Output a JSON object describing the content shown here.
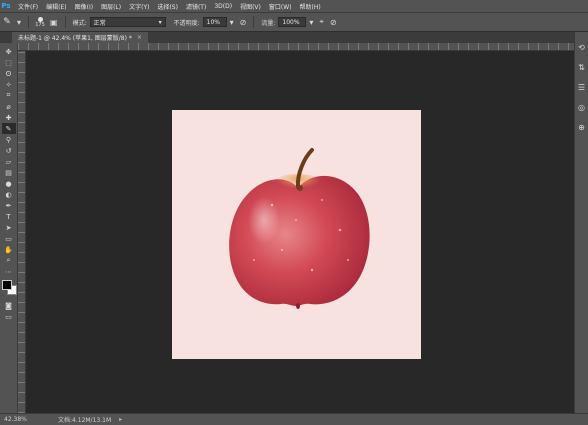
{
  "app": {
    "logo": "Ps"
  },
  "menu": [
    "文件(F)",
    "编辑(E)",
    "图像(I)",
    "图层(L)",
    "文字(Y)",
    "选择(S)",
    "滤镜(T)",
    "3D(D)",
    "视图(V)",
    "窗口(W)",
    "帮助(H)"
  ],
  "options": {
    "brush_size": "175",
    "mode_label": "模式:",
    "mode_value": "正常",
    "opacity_label": "不透明度:",
    "opacity_value": "10%",
    "flow_label": "流量:",
    "flow_value": "100%"
  },
  "document": {
    "tab_title": "未标题-1 @ 42.4% (苹果1, 图层蒙版/8) *",
    "tab_close": "×"
  },
  "status": {
    "zoom": "42.38%",
    "doc_info": "文档:4.12M/13.1M",
    "arrow": "▸"
  },
  "colors": {
    "canvas_bg": "#f7e2e0",
    "workspace": "#282828",
    "panel": "#535353",
    "accent": "#31a8ff"
  },
  "icons": {
    "tools": [
      "move-icon",
      "marquee-icon",
      "lasso-icon",
      "magic-wand-icon",
      "crop-icon",
      "eyedropper-icon",
      "healing-icon",
      "brush-icon",
      "clone-stamp-icon",
      "history-brush-icon",
      "eraser-icon",
      "gradient-icon",
      "blur-icon",
      "dodge-icon",
      "pen-icon",
      "type-icon",
      "path-select-icon",
      "shape-icon",
      "hand-icon",
      "zoom-icon"
    ],
    "right": [
      "history-icon",
      "adjust-icon",
      "layers-icon",
      "channels-icon",
      "paths-icon"
    ]
  }
}
